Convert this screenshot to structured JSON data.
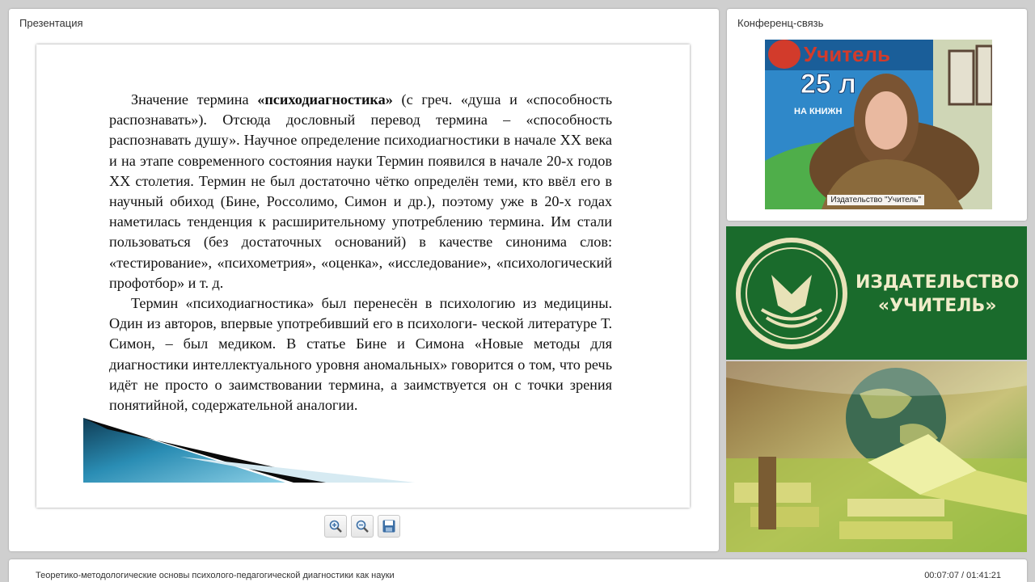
{
  "presentation_panel": {
    "title": "Презентация",
    "slide": {
      "paragraph1": {
        "before": "Значение термина ",
        "bold": "«психодиагностика»",
        "after": " (с греч. «душа и «способность распознавать»). Отсюда дословный перевод термина – «способность распознавать душу». Научное определение психодиагностики в начале XX века и на этапе современного состояния науки Термин появился в начале 20-х годов XX столетия. Термин не был достаточно чётко определён теми, кто ввёл его в научный обиход (Бине, Россолимо, Симон и др.), поэтому уже в 20-х годах наметилась тенденция к расширительному употреблению термина. Им стали пользоваться (без достаточных оснований) в качестве синонима слов: «тестирование», «психометрия», «оценка», «исследование», «психологический профотбор» и т. д."
      },
      "paragraph2": "Термин «психодиагностика» был перенесён в психологию из медицины. Один из авторов, впервые употребивший его в психологи- ческой литературе Т. Симон, – был медиком. В статье Бине и Симона «Новые методы для диагностики интеллектуального уровня аномальных» говорится о том, что речь идёт не просто о заимствовании термина, а заимствуется он с точки зрения понятийной, содержательной аналогии."
    },
    "toolbar": [
      "zoom-in-icon",
      "zoom-out-icon",
      "save-icon"
    ]
  },
  "conference_panel": {
    "title": "Конференц-связь",
    "video_caption": "Издательство \"Учитель\""
  },
  "brand": {
    "line1": "ИЗДАТЕЛЬСТВО",
    "line2": "«УЧИТЕЛЬ»",
    "colors": {
      "background": "#1a6b2c",
      "text": "#f0ecc9"
    }
  },
  "status_bar": {
    "lecture_title": "Теоретико-методологические основы психолого-педагогической диагностики как науки",
    "time": "00:07:07 / 01:41:21"
  }
}
